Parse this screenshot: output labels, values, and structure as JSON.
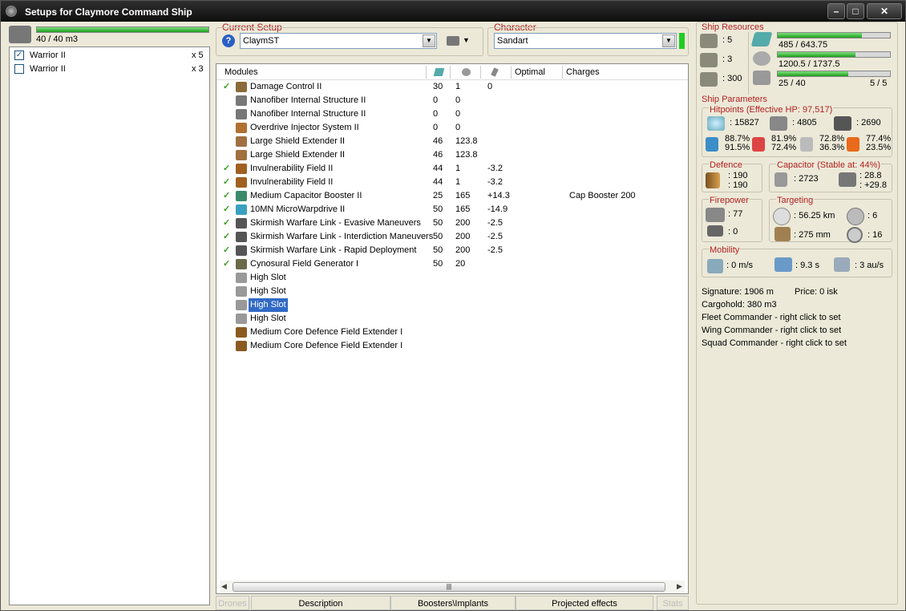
{
  "window": {
    "title": "Setups for Claymore Command Ship"
  },
  "drones": {
    "bandwidth": "40 / 40 m3",
    "bandwidth_fraction": 1.0,
    "items": [
      {
        "name": "Warrior II",
        "count": "x 5",
        "checked": true
      },
      {
        "name": "Warrior II",
        "count": "x 3",
        "checked": false
      }
    ]
  },
  "setup": {
    "label": "Current Setup",
    "value": "ClaymST"
  },
  "character": {
    "label": "Character",
    "value": "Sandart"
  },
  "modules": {
    "headers": [
      "Modules",
      "",
      "",
      "",
      "Optimal",
      "Charges"
    ],
    "rows": [
      {
        "active": true,
        "name": "Damage Control II",
        "v1": "30",
        "v2": "1",
        "v3": "0",
        "charge": ""
      },
      {
        "active": false,
        "name": "Nanofiber Internal Structure II",
        "v1": "0",
        "v2": "0",
        "v3": "",
        "charge": ""
      },
      {
        "active": false,
        "name": "Nanofiber Internal Structure II",
        "v1": "0",
        "v2": "0",
        "v3": "",
        "charge": ""
      },
      {
        "active": false,
        "name": "Overdrive Injector System II",
        "v1": "0",
        "v2": "0",
        "v3": "",
        "charge": ""
      },
      {
        "active": false,
        "name": "Large Shield Extender II",
        "v1": "46",
        "v2": "123.8",
        "v3": "",
        "charge": ""
      },
      {
        "active": false,
        "name": "Large Shield Extender II",
        "v1": "46",
        "v2": "123.8",
        "v3": "",
        "charge": ""
      },
      {
        "active": true,
        "name": "Invulnerability Field II",
        "v1": "44",
        "v2": "1",
        "v3": "-3.2",
        "charge": ""
      },
      {
        "active": true,
        "name": "Invulnerability Field II",
        "v1": "44",
        "v2": "1",
        "v3": "-3.2",
        "charge": ""
      },
      {
        "active": true,
        "name": "Medium Capacitor Booster II",
        "v1": "25",
        "v2": "165",
        "v3": "+14.3",
        "charge": "Cap Booster 200"
      },
      {
        "active": true,
        "name": "10MN MicroWarpdrive II",
        "v1": "50",
        "v2": "165",
        "v3": "-14.9",
        "charge": ""
      },
      {
        "active": true,
        "name": "Skirmish Warfare Link - Evasive Maneuvers",
        "v1": "50",
        "v2": "200",
        "v3": "-2.5",
        "charge": ""
      },
      {
        "active": true,
        "name": "Skirmish Warfare Link - Interdiction Maneuvers",
        "v1": "50",
        "v2": "200",
        "v3": "-2.5",
        "charge": ""
      },
      {
        "active": true,
        "name": "Skirmish Warfare Link - Rapid Deployment",
        "v1": "50",
        "v2": "200",
        "v3": "-2.5",
        "charge": ""
      },
      {
        "active": true,
        "name": "Cynosural Field Generator I",
        "v1": "50",
        "v2": "20",
        "v3": "",
        "charge": ""
      },
      {
        "active": false,
        "name": "High Slot",
        "v1": "",
        "v2": "",
        "v3": "",
        "charge": ""
      },
      {
        "active": false,
        "name": "High Slot",
        "v1": "",
        "v2": "",
        "v3": "",
        "charge": ""
      },
      {
        "active": false,
        "name": "High Slot",
        "v1": "",
        "v2": "",
        "v3": "",
        "charge": "",
        "selected": true
      },
      {
        "active": false,
        "name": "High Slot",
        "v1": "",
        "v2": "",
        "v3": "",
        "charge": ""
      },
      {
        "active": false,
        "name": "Medium Core Defence Field Extender I",
        "v1": "",
        "v2": "",
        "v3": "",
        "charge": ""
      },
      {
        "active": false,
        "name": "Medium Core Defence Field Extender I",
        "v1": "",
        "v2": "",
        "v3": "",
        "charge": ""
      }
    ]
  },
  "tabs": [
    "Drones",
    "Description",
    "Boosters\\Implants",
    "Projected effects",
    "Stats"
  ],
  "resources": {
    "label": "Ship Resources",
    "hardpoints": [
      ": 5",
      ": 3",
      ": 300"
    ],
    "cpu": "485 / 643.75",
    "cpu_fraction": 0.75,
    "power": "1200.5 / 1737.5",
    "power_fraction": 0.69,
    "calibration": "25 / 40",
    "calibration_fraction": 0.63,
    "slots": "5 / 5"
  },
  "params": {
    "label": "Ship Parameters",
    "hitpoints": {
      "label": "Hitpoints (Effective HP: 97,517)",
      "shield": ": 15827",
      "armor": ": 4805",
      "structure": ": 2690",
      "res": [
        [
          "88.7%",
          "91.5%"
        ],
        [
          "81.9%",
          "72.4%"
        ],
        [
          "72.8%",
          "36.3%"
        ],
        [
          "77.4%",
          "23.5%"
        ]
      ]
    },
    "defence": {
      "label": "Defence",
      "a": ": 190",
      "b": ": 190"
    },
    "capacitor": {
      "label": "Capacitor (Stable at: 44%)",
      "amount": ": 2723",
      "a": ": 28.8",
      "b": ": +29.8"
    },
    "firepower": {
      "label": "Firepower",
      "dps": ": 77",
      "volley": ": 0"
    },
    "targeting": {
      "label": "Targeting",
      "range": ": 56.25 km",
      "targets": ": 6",
      "scan": ": 275 mm",
      "sensor": ": 16"
    },
    "mobility": {
      "label": "Mobility",
      "speed": ": 0 m/s",
      "align": ": 9.3 s",
      "warp": ": 3 au/s"
    },
    "signature": "Signature: 1906 m",
    "price": "Price: 0 isk",
    "cargo": "Cargohold: 380 m3",
    "fleet": "Fleet Commander - right click to set",
    "wing": "Wing Commander - right click to set",
    "squad": "Squad Commander - right click to set"
  }
}
